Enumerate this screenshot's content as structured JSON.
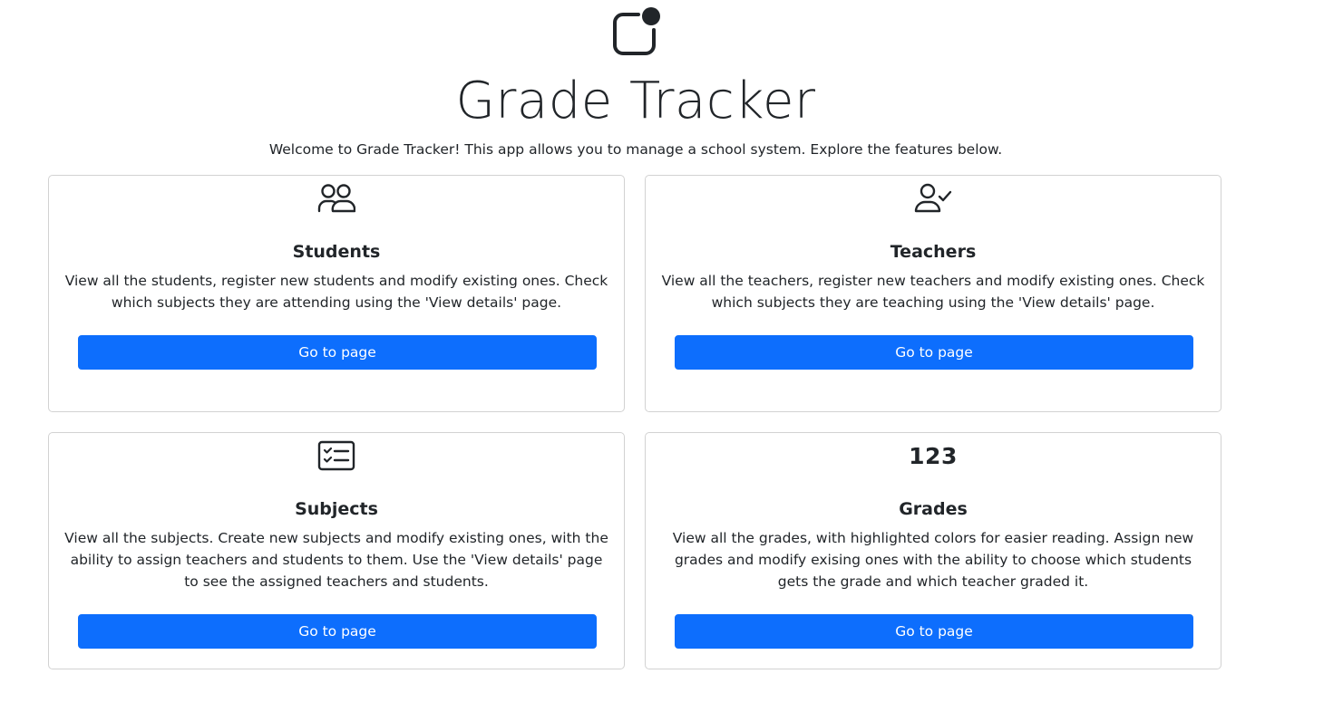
{
  "header": {
    "logo_icon": "app-logo-icon",
    "title": "Grade Tracker",
    "intro": "Welcome to Grade Tracker! This app allows you to manage a school system. Explore the features below."
  },
  "cards": [
    {
      "icon": "people-icon",
      "title": "Students",
      "text": "View all the students, register new students and modify existing ones. Check which subjects they are attending using the 'View details' page.",
      "button_label": "Go to page"
    },
    {
      "icon": "person-check-icon",
      "title": "Teachers",
      "text": "View all the teachers, register new teachers and modify existing ones. Check which subjects they are teaching using the 'View details' page.",
      "button_label": "Go to page"
    },
    {
      "icon": "card-checklist-icon",
      "title": "Subjects",
      "text": "View all the subjects. Create new subjects and modify existing ones, with the ability to assign teachers and students to them. Use the 'View details' page to see the assigned teachers and students.",
      "button_label": "Go to page"
    },
    {
      "icon_text": "123",
      "title": "Grades",
      "text": "View all the grades, with highlighted colors for easier reading. Assign new grades and modify exising ones with the ability to choose which students gets the grade and which teacher graded it.",
      "button_label": "Go to page"
    }
  ],
  "colors": {
    "primary": "#0d6efd",
    "text": "#212529",
    "border": "#dee2e6"
  }
}
